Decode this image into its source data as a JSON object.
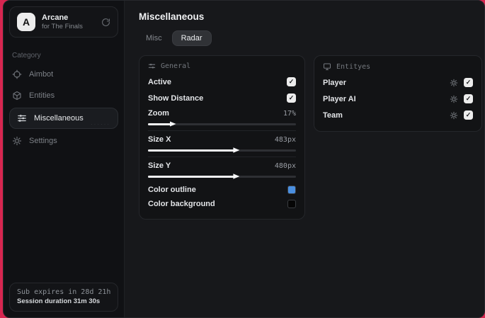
{
  "window": {
    "accent_color": "#d72650"
  },
  "app": {
    "logo_letter": "A",
    "title": "Arcane",
    "subtitle": "for The Finals"
  },
  "sidebar": {
    "category_label": "Category",
    "items": [
      {
        "label": "Aimbot",
        "icon": "crosshair-icon",
        "active": false
      },
      {
        "label": "Entities",
        "icon": "cube-icon",
        "active": false
      },
      {
        "label": "Miscellaneous",
        "icon": "sliders-icon",
        "active": true
      },
      {
        "label": "Settings",
        "icon": "gear-icon",
        "active": false
      }
    ],
    "footer": {
      "sub_line": "Sub expires in 28d 21h",
      "session_line": "Session duration 31m 30s"
    }
  },
  "main": {
    "page_title": "Miscellaneous",
    "tabs": [
      {
        "label": "Misc",
        "active": false
      },
      {
        "label": "Radar",
        "active": true
      }
    ],
    "general_card": {
      "header": "General",
      "toggles": [
        {
          "label": "Active",
          "checked": true
        },
        {
          "label": "Show Distance",
          "checked": true
        }
      ],
      "sliders": [
        {
          "label": "Zoom",
          "value": "17%",
          "percent": 17
        },
        {
          "label": "Size X",
          "value": "483px",
          "percent": 60
        },
        {
          "label": "Size Y",
          "value": "480px",
          "percent": 60
        }
      ],
      "colors": [
        {
          "label": "Color outline",
          "swatch": "#4a8fe0"
        },
        {
          "label": "Color background",
          "swatch": "#060606"
        }
      ]
    },
    "entities_card": {
      "header": "Entityes",
      "rows": [
        {
          "label": "Player",
          "checked": true
        },
        {
          "label": "Player AI",
          "checked": true
        },
        {
          "label": "Team",
          "checked": true
        }
      ]
    }
  }
}
